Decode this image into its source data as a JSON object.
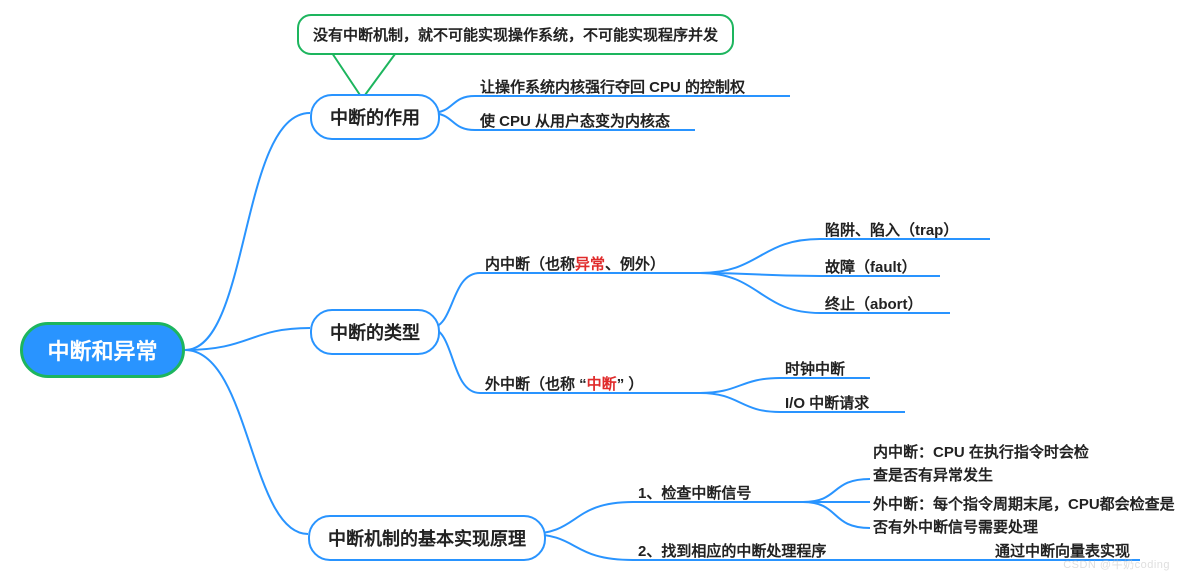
{
  "root": "中断和异常",
  "callout": "没有中断机制，就不可能实现操作系统，不可能实现程序并发",
  "nodes": {
    "role": "中断的作用",
    "types": "中断的类型",
    "mech": "中断机制的基本实现原理"
  },
  "leaves": {
    "role1": "让操作系统内核强行夺回 CPU 的控制权",
    "role2": "使 CPU 从用户态变为内核态",
    "inner_pre": "内中断（也称",
    "inner_red": "异常",
    "inner_post": "、例外）",
    "outer_pre": "外中断（也称 “",
    "outer_red": "中断",
    "outer_post": "” ）",
    "trap": "陷阱、陷入（trap）",
    "fault": "故障（fault）",
    "abort": "终止（abort）",
    "timer": "时钟中断",
    "io": "I/O 中断请求",
    "check": "1、检查中断信号",
    "locate": "2、找到相应的中断处理程序",
    "chk_inner": "内中断：CPU 在执行指令时会检查是否有异常发生",
    "chk_outer": "外中断：每个指令周期末尾，CPU都会检查是否有外中断信号需要处理",
    "locate_how": "通过中断向量表实现"
  },
  "watermark": "CSDN @牛奶coding"
}
